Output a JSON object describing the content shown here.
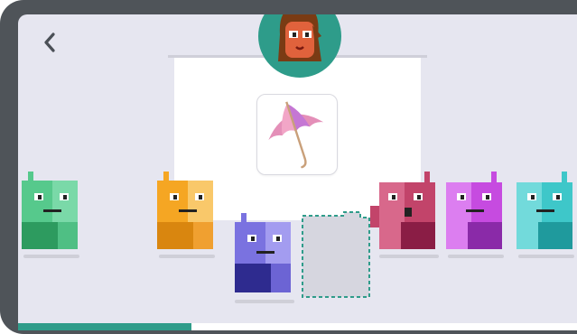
{
  "nav": {
    "back_icon": "chevron-left-icon"
  },
  "prompt": {
    "image_icon": "umbrella-icon",
    "avatar_icon": "girl-avatar-icon"
  },
  "robots": [
    {
      "name": "green",
      "color": "#56c98c",
      "dark": "#2d9b5f"
    },
    {
      "name": "orange",
      "color": "#f5a623",
      "dark": "#d9860f"
    },
    {
      "name": "blue",
      "color": "#7a72e0",
      "dark": "#2e2b8f"
    },
    {
      "name": "red",
      "color": "#c2446a",
      "dark": "#8a1d45"
    },
    {
      "name": "magenta",
      "color": "#c64be0",
      "dark": "#8a2aa8"
    },
    {
      "name": "teal",
      "color": "#3ec7c9",
      "dark": "#1f9a9d"
    }
  ],
  "answer_slot": {
    "state": "empty"
  },
  "progress": {
    "fraction": 0.31,
    "color": "#2f9c8a"
  },
  "colors": {
    "frame": "#4f5459",
    "background": "#e6e6f0",
    "accent": "#2f9c8a"
  }
}
